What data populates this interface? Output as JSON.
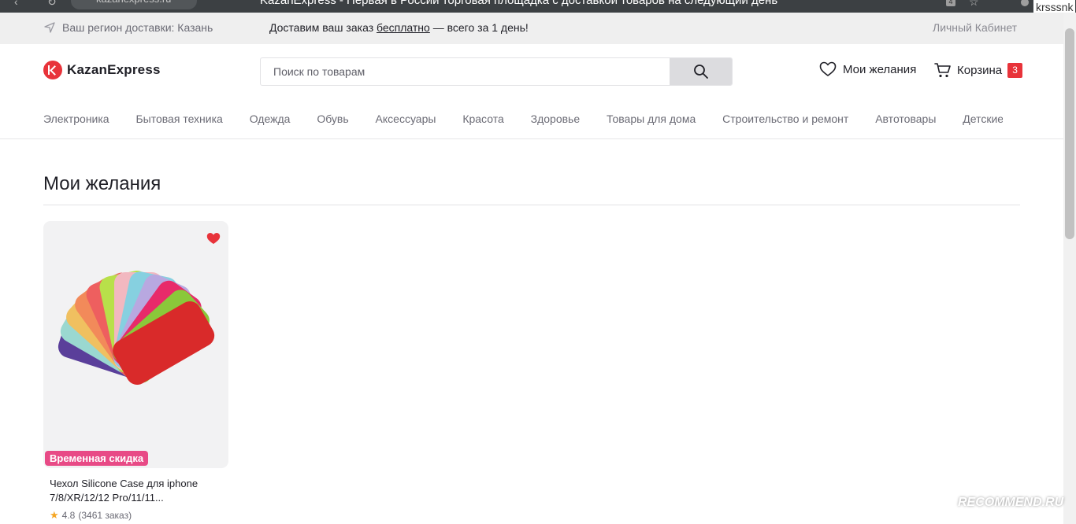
{
  "browser": {
    "tab_url": "kazanexpress.ru",
    "window_title": "KazanExpress - Первая в России торговая площадка с доставкой товаров на следующий день",
    "extension_count": "4",
    "user_name": "krsssnk"
  },
  "topbar": {
    "region_text": "Ваш регион доставки: Казань",
    "promo_before": "Доставим ваш заказ ",
    "promo_link": "бесплатно",
    "promo_after": " — всего за 1 день!",
    "cabinet_label": "Личный Кабинет"
  },
  "header": {
    "logo_text": "KazanExpress",
    "search_placeholder": "Поиск по товарам",
    "wishlist_label": "Мои желания",
    "cart_label": "Корзина",
    "cart_count": "3"
  },
  "categories": [
    "Электроника",
    "Бытовая техника",
    "Одежда",
    "Обувь",
    "Аксессуары",
    "Красота",
    "Здоровье",
    "Товары для дома",
    "Строительство и ремонт",
    "Автотовары",
    "Детские товары"
  ],
  "page": {
    "title": "Мои желания"
  },
  "products": [
    {
      "badge": "Временная скидка",
      "name": "Чехол Silicone Case для iphone 7/8/XR/12/12 Pro/11/11...",
      "rating": "4.8",
      "orders": "(3461 заказ)"
    }
  ],
  "colors": {
    "brand_red": "#e8333a",
    "badge_pink": "#e84a86",
    "star_gold": "#f5a623"
  },
  "watermark": "RECOMMEND.RU"
}
